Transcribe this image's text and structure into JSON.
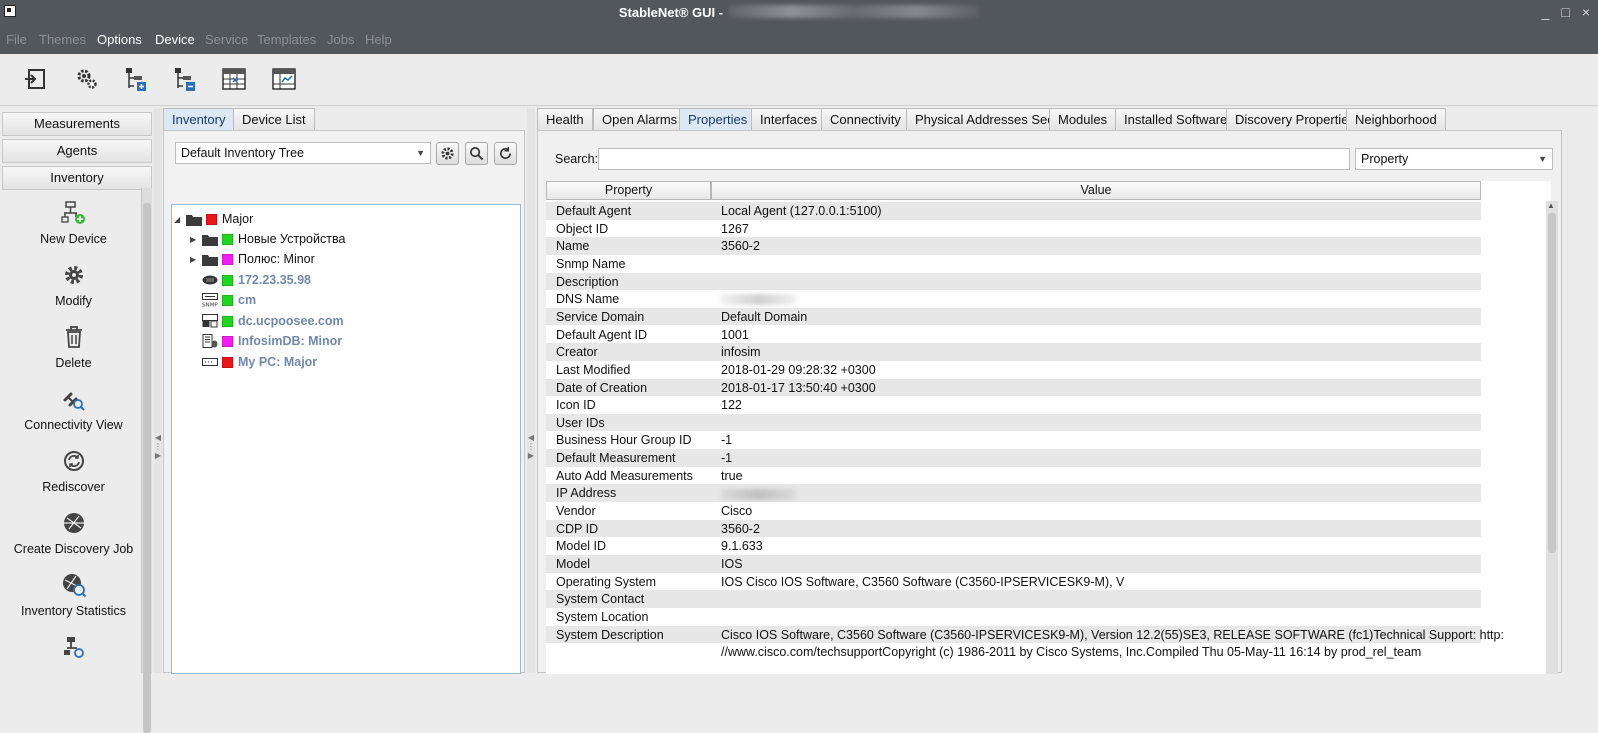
{
  "window": {
    "title": "StableNet® GUI -",
    "controls": {
      "minimize": "_",
      "maximize": "□",
      "close": "×"
    }
  },
  "menu": [
    {
      "label": "File",
      "enabled": false
    },
    {
      "label": "Themes",
      "enabled": false
    },
    {
      "label": "Options",
      "enabled": true
    },
    {
      "label": "Device",
      "enabled": true
    },
    {
      "label": "Service",
      "enabled": false
    },
    {
      "label": "Templates",
      "enabled": false
    },
    {
      "label": "Jobs",
      "enabled": false
    },
    {
      "label": "Help",
      "enabled": false
    }
  ],
  "toolbar": {
    "icons": [
      "exit-icon",
      "settings-icon",
      "tree-add-icon",
      "tree-remove-icon",
      "table-grid-icon",
      "table-chart-icon"
    ]
  },
  "leftnav": {
    "sections": [
      "Measurements",
      "Agents",
      "Inventory"
    ],
    "actions": [
      {
        "label": "New Device",
        "icon": "new-device-icon"
      },
      {
        "label": "Modify",
        "icon": "gear-icon"
      },
      {
        "label": "Delete",
        "icon": "trash-icon"
      },
      {
        "label": "Connectivity View",
        "icon": "connectivity-icon"
      },
      {
        "label": "Rediscover",
        "icon": "rediscover-icon"
      },
      {
        "label": "Create Discovery Job",
        "icon": "discovery-job-icon"
      },
      {
        "label": "Inventory Statistics",
        "icon": "statistics-icon"
      }
    ]
  },
  "inventory": {
    "tabs": [
      "Inventory",
      "Device List"
    ],
    "active_tab": "Inventory",
    "tree_selector": "Default Inventory Tree",
    "tree": [
      {
        "label": "Major",
        "status_color": "#e8151b",
        "type": "folder",
        "level": 0,
        "expanded": true
      },
      {
        "label": "Новые Устройства",
        "status_color": "#22d322",
        "type": "folder",
        "level": 1
      },
      {
        "label": "Полюс: Minor",
        "status_color": "#f21df0",
        "type": "folder",
        "level": 1
      },
      {
        "label": "172.23.35.98",
        "status_color": "#22d322",
        "type": "router",
        "level": 1
      },
      {
        "label": "cm",
        "status_color": "#22d322",
        "type": "snmp",
        "level": 1
      },
      {
        "label": "dc.ucpoosee.com",
        "status_color": "#22d322",
        "type": "server",
        "level": 1
      },
      {
        "label": "InfosimDB: Minor",
        "status_color": "#f21df0",
        "type": "database",
        "level": 1
      },
      {
        "label": "My PC: Major",
        "status_color": "#e8151b",
        "type": "pc",
        "level": 1
      }
    ]
  },
  "details": {
    "tabs": [
      "Health",
      "Open Alarms",
      "Properties",
      "Interfaces",
      "Connectivity",
      "Physical Addresses Seen",
      "Modules",
      "Installed Software",
      "Discovery Properties",
      "Neighborhood"
    ],
    "active_tab": "Properties",
    "search_label": "Search:",
    "search_value": "",
    "filter_field": "Property",
    "columns": [
      "Property",
      "Value"
    ],
    "rows": [
      [
        "Default Agent",
        "Local Agent (127.0.0.1:5100)"
      ],
      [
        "Object ID",
        "1267"
      ],
      [
        "Name",
        "3560-2"
      ],
      [
        "Snmp Name",
        ""
      ],
      [
        "Description",
        ""
      ],
      [
        "DNS Name",
        "[redacted]"
      ],
      [
        "Service Domain",
        "Default Domain"
      ],
      [
        "Default Agent ID",
        "1001"
      ],
      [
        "Creator",
        "infosim"
      ],
      [
        "Last Modified",
        "2018-01-29 09:28:32 +0300"
      ],
      [
        "Date of Creation",
        "2018-01-17 13:50:40 +0300"
      ],
      [
        "Icon ID",
        "122"
      ],
      [
        "User IDs",
        ""
      ],
      [
        "Business Hour Group ID",
        "-1"
      ],
      [
        "Default Measurement",
        "-1"
      ],
      [
        "Auto Add Measurements",
        "true"
      ],
      [
        "IP Address",
        "[redacted]"
      ],
      [
        "Vendor",
        "Cisco"
      ],
      [
        "CDP ID",
        "3560-2"
      ],
      [
        "Model ID",
        "9.1.633"
      ],
      [
        "Model",
        "IOS"
      ],
      [
        "Operating System",
        "IOS Cisco IOS Software, C3560 Software (C3560-IPSERVICESK9-M), V"
      ],
      [
        "System Contact",
        ""
      ],
      [
        "System Location",
        ""
      ],
      [
        "System Description",
        "Cisco IOS Software, C3560 Software (C3560-IPSERVICESK9-M), Version 12.2(55)SE3, RELEASE SOFTWARE (fc1)Technical Support: http:"
      ],
      [
        "",
        "//www.cisco.com/techsupportCopyright (c) 1986-2011 by Cisco Systems, Inc.Compiled Thu 05-May-11 16:14 by prod_rel_team"
      ]
    ]
  }
}
